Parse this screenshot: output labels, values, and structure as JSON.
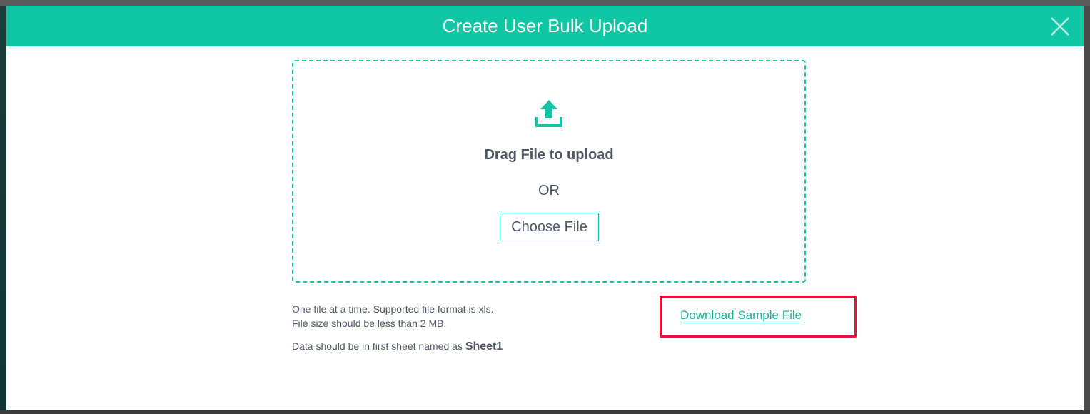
{
  "modal": {
    "title": "Create User Bulk Upload",
    "close_icon": "close-icon"
  },
  "dropzone": {
    "icon": "upload-icon",
    "drag_text": "Drag File to upload",
    "or_text": "OR",
    "choose_button_label": "Choose File"
  },
  "info": {
    "line1": "One file at a time. Supported file format is xls.",
    "line2": "File size should be less than 2 MB.",
    "sheet_prefix": "Data should be in first sheet named as",
    "sheet_name": "Sheet1"
  },
  "download": {
    "label": "Download Sample File"
  },
  "colors": {
    "accent": "#0fc7a4",
    "text": "#4f5866",
    "highlight": "#e0183b"
  }
}
